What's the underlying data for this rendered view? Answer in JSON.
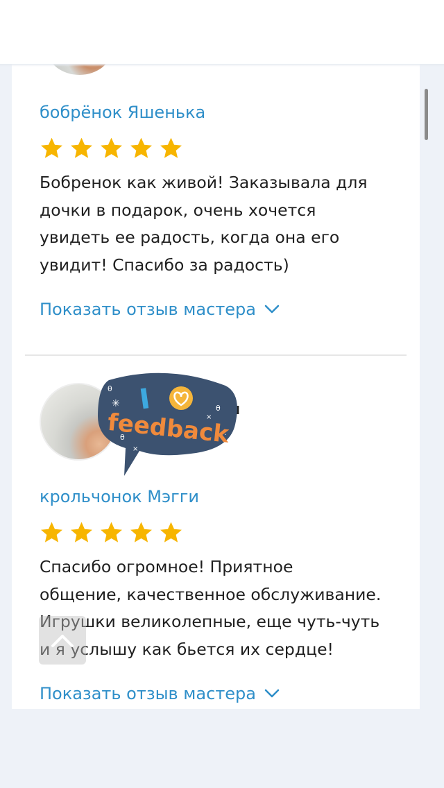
{
  "reviews": [
    {
      "author": "бобрёнок Яшенька",
      "rating": 5,
      "text_lines": [
        "Бобренок как живой! Заказывала для",
        "дочки в подарок, очень хочется",
        "увидеть ее радость, когда она его",
        "увидит! Спасибо за радость)"
      ],
      "show_master_label": "Показать отзыв мастера"
    },
    {
      "author": "крольчонок Мэгги",
      "rating": 5,
      "text_lines": [
        "Спасибо огромное! Приятное",
        "общение, качественное обслуживание.",
        "Игрушки великолепные, еще чуть-чуть",
        "и я услышу как бьется их сердце!"
      ],
      "show_master_label": "Показать отзыв мастера"
    }
  ],
  "sticker": {
    "line1": "I",
    "line2": "feedback",
    "icon": "heart-icon"
  },
  "colors": {
    "link": "#2f8fc9",
    "star": "#f7b500",
    "sticker_bg": "#3c5270",
    "sticker_text": "#f08a3c"
  }
}
